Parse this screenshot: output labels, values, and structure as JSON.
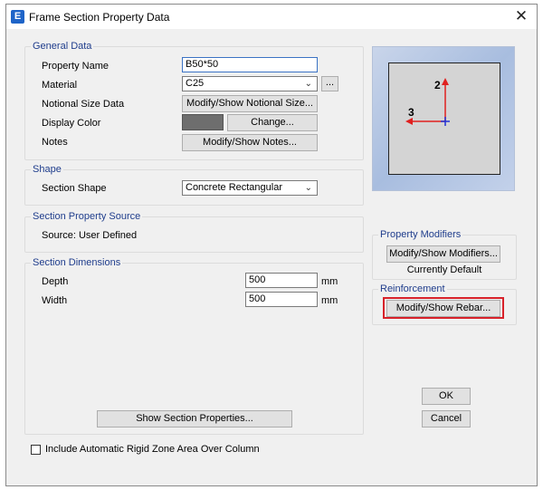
{
  "window": {
    "icon_letter": "E",
    "title": "Frame Section Property Data",
    "close_glyph": "✕"
  },
  "general_data": {
    "title": "General Data",
    "property_name_label": "Property Name",
    "property_name_value": "B50*50",
    "material_label": "Material",
    "material_value": "C25",
    "material_more_label": "...",
    "notional_label": "Notional Size Data",
    "notional_button": "Modify/Show Notional Size...",
    "display_color_label": "Display Color",
    "display_color_value": "#6e6e6e",
    "change_button": "Change...",
    "notes_label": "Notes",
    "notes_button": "Modify/Show Notes..."
  },
  "shape": {
    "title": "Shape",
    "section_shape_label": "Section Shape",
    "section_shape_value": "Concrete Rectangular"
  },
  "section_property_source": {
    "title": "Section Property Source",
    "source_text": "Source:  User Defined"
  },
  "section_dimensions": {
    "title": "Section Dimensions",
    "depth_label": "Depth",
    "depth_value": "500",
    "depth_unit": "mm",
    "width_label": "Width",
    "width_value": "500",
    "width_unit": "mm",
    "show_properties_button": "Show Section Properties..."
  },
  "preview": {
    "axis_2_label": "2",
    "axis_3_label": "3"
  },
  "property_modifiers": {
    "title": "Property Modifiers",
    "button": "Modify/Show Modifiers...",
    "status": "Currently Default"
  },
  "reinforcement": {
    "title": "Reinforcement",
    "button": "Modify/Show Rebar..."
  },
  "footer": {
    "ok": "OK",
    "cancel": "Cancel",
    "rigid_zone_label": "Include Automatic Rigid Zone Area Over Column",
    "rigid_zone_checked": false
  },
  "colors": {
    "group_title": "#1f3d8c",
    "highlight": "#d8222a",
    "axis_red": "#e0201f",
    "axis_blue": "#2232d6"
  }
}
